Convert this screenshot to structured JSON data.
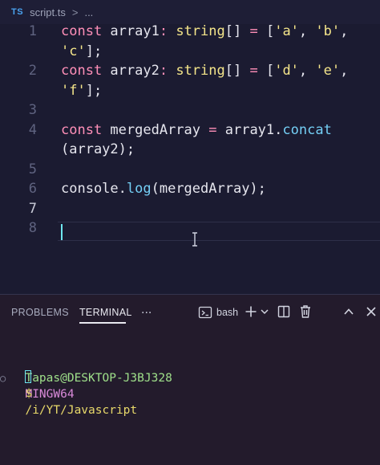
{
  "breadcrumb": {
    "lang_badge": "TS",
    "file": "script.ts",
    "separator": ">",
    "more": "..."
  },
  "editor": {
    "lines": [
      {
        "num": "1",
        "parts": [
          {
            "t": "const ",
            "c": "kw"
          },
          {
            "t": "array1",
            "c": "plain"
          },
          {
            "t": ": ",
            "c": "kw"
          },
          {
            "t": "string",
            "c": "typ"
          },
          {
            "t": "[] ",
            "c": "plain"
          },
          {
            "t": "=",
            "c": "kw"
          },
          {
            "t": " [",
            "c": "plain"
          },
          {
            "t": "'a'",
            "c": "str"
          },
          {
            "t": ", ",
            "c": "plain"
          },
          {
            "t": "'b'",
            "c": "str"
          },
          {
            "t": ",",
            "c": "plain"
          }
        ]
      },
      {
        "num": "",
        "parts": [
          {
            "t": "'c'",
            "c": "str"
          },
          {
            "t": "];",
            "c": "plain"
          }
        ]
      },
      {
        "num": "2",
        "parts": [
          {
            "t": "const ",
            "c": "kw"
          },
          {
            "t": "array2",
            "c": "plain"
          },
          {
            "t": ": ",
            "c": "kw"
          },
          {
            "t": "string",
            "c": "typ"
          },
          {
            "t": "[] ",
            "c": "plain"
          },
          {
            "t": "=",
            "c": "kw"
          },
          {
            "t": " [",
            "c": "plain"
          },
          {
            "t": "'d'",
            "c": "str"
          },
          {
            "t": ", ",
            "c": "plain"
          },
          {
            "t": "'e'",
            "c": "str"
          },
          {
            "t": ",",
            "c": "plain"
          }
        ]
      },
      {
        "num": "",
        "parts": [
          {
            "t": "'f'",
            "c": "str"
          },
          {
            "t": "];",
            "c": "plain"
          }
        ]
      },
      {
        "num": "3",
        "parts": []
      },
      {
        "num": "4",
        "parts": [
          {
            "t": "const ",
            "c": "kw"
          },
          {
            "t": "mergedArray ",
            "c": "plain"
          },
          {
            "t": "=",
            "c": "kw"
          },
          {
            "t": " array1.",
            "c": "plain"
          },
          {
            "t": "concat",
            "c": "fn"
          }
        ]
      },
      {
        "num": "",
        "parts": [
          {
            "t": "(array2);",
            "c": "plain"
          }
        ]
      },
      {
        "num": "5",
        "parts": []
      },
      {
        "num": "6",
        "parts": [
          {
            "t": "console.",
            "c": "plain"
          },
          {
            "t": "log",
            "c": "fn"
          },
          {
            "t": "(mergedArray);",
            "c": "plain"
          }
        ]
      },
      {
        "num": "7",
        "parts": [],
        "active": true
      },
      {
        "num": "8",
        "parts": []
      }
    ]
  },
  "panel": {
    "tabs": [
      {
        "label": "PROBLEMS",
        "active": false
      },
      {
        "label": "TERMINAL",
        "active": true
      }
    ],
    "more": "...",
    "shell_label": "bash",
    "tool_icons": [
      "terminal-icon",
      "plus-icon",
      "chevron-down-icon",
      "split-icon",
      "trash-icon",
      "chevron-up-icon",
      "close-icon"
    ]
  },
  "terminal": {
    "user_host": "Tapas@DESKTOP-J3BJ328",
    "system": "MINGW64",
    "path": "/i/YT/Javascript",
    "prompt": "$"
  },
  "colors": {
    "background": "#1b1b31",
    "panel": "#231b2c",
    "keyword": "#ff8fb8",
    "string": "#f4e58a",
    "function": "#74cff5"
  }
}
